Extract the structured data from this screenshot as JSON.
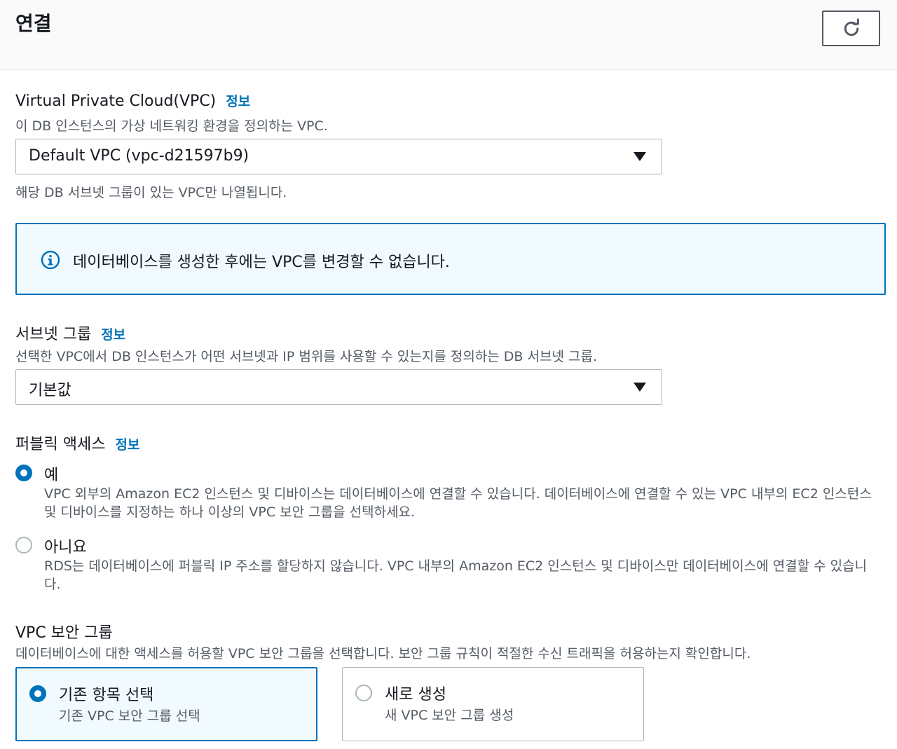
{
  "header": {
    "title": "연결",
    "refresh_icon": "refresh-icon"
  },
  "vpc": {
    "label": "Virtual Private Cloud(VPC)",
    "info_link": "정보",
    "description": "이 DB 인스턴스의 가상 네트워킹 환경을 정의하는 VPC.",
    "selected": "Default VPC (vpc-d21597b9)",
    "hint": "해당 DB 서브넷 그룹이 있는 VPC만 나열됩니다."
  },
  "alert": {
    "icon": "info-icon",
    "text": "데이터베이스를 생성한 후에는 VPC를 변경할 수 없습니다."
  },
  "subnet_group": {
    "label": "서브넷 그룹",
    "info_link": "정보",
    "description": "선택한 VPC에서 DB 인스턴스가 어떤 서브넷과 IP 범위를 사용할 수 있는지를 정의하는 DB 서브넷 그룹.",
    "selected": "기본값"
  },
  "public_access": {
    "label": "퍼블릭 액세스",
    "info_link": "정보",
    "options": [
      {
        "label": "예",
        "checked": true,
        "description_line1": "VPC 외부의 Amazon EC2 인스턴스 및 디바이스는 데이터베이스에 연결할 수 있습니다. 데이터베이스에 연결할 수 있는 VPC 내부의 EC2 인스턴스",
        "description_line2": "및 디바이스를 지정하는 하나 이상의 VPC 보안 그룹을 선택하세요."
      },
      {
        "label": "아니요",
        "checked": false,
        "description_line1": "RDS는 데이터베이스에 퍼블릭 IP 주소를 할당하지 않습니다. VPC 내부의 Amazon EC2 인스턴스 및 디바이스만 데이터베이스에 연결할 수 있습니",
        "description_line2": "다."
      }
    ]
  },
  "security_group": {
    "label": "VPC 보안 그룹",
    "description": "데이터베이스에 대한 액세스를 허용할 VPC 보안 그룹을 선택합니다. 보안 그룹 규칙이 적절한 수신 트래픽을 허용하는지 확인합니다.",
    "tiles": [
      {
        "title": "기존 항목 선택",
        "description": "기존 VPC 보안 그룹 선택",
        "selected": true
      },
      {
        "title": "새로 생성",
        "description": "새 VPC 보안 그룹 생성",
        "selected": false
      }
    ]
  },
  "colors": {
    "accent": "#0073bb",
    "text": "#16191f",
    "muted": "#545b64",
    "border": "#aab7b8",
    "info_bg": "#f1faff"
  }
}
